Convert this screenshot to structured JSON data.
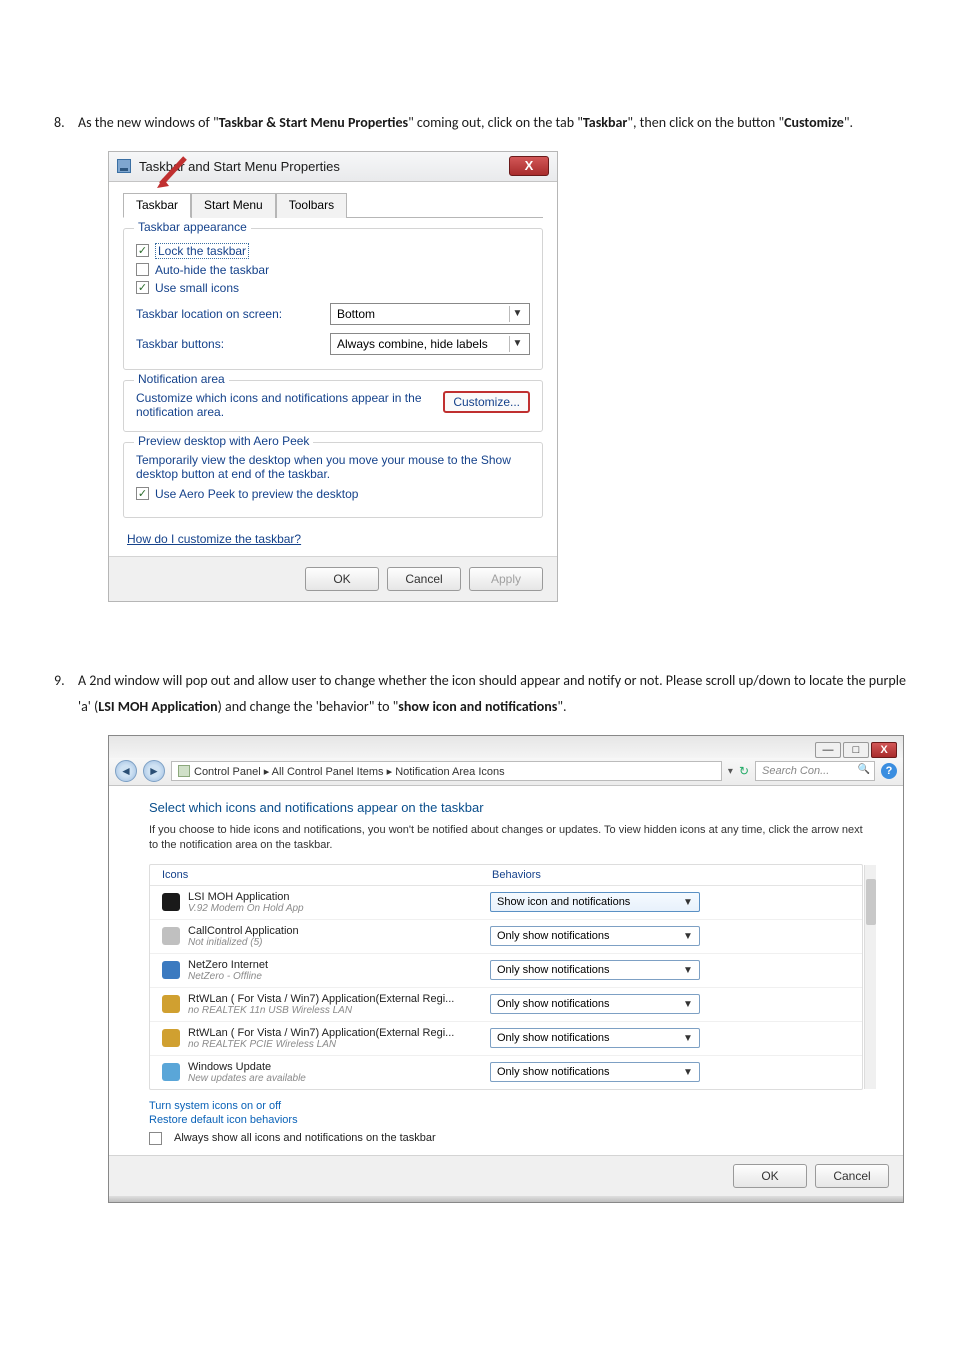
{
  "step8": {
    "num": "8.",
    "pre": "As the new windows of \"",
    "b1": "Taskbar & Start Menu Properties",
    "mid1": "\" coming out, click on the tab \"",
    "b2": "Taskbar",
    "mid2": "\", then click on the button \"",
    "b3": "Customize",
    "end": "\"."
  },
  "dialog1": {
    "title": "Taskbar and Start Menu Properties",
    "close": "X",
    "tabs": {
      "t1": "Taskbar",
      "t2": "Start Menu",
      "t3": "Toolbars"
    },
    "appearanceLegend": "Taskbar appearance",
    "lock": "Lock the taskbar",
    "autohide": "Auto-hide the taskbar",
    "smallicons": "Use small icons",
    "locLabel": "Taskbar location on screen:",
    "locValue": "Bottom",
    "btnsLabel": "Taskbar buttons:",
    "btnsValue": "Always combine, hide labels",
    "notifLegend": "Notification area",
    "notifText": "Customize which icons and notifications appear in the notification area.",
    "custBtn": "Customize...",
    "peekLegend": "Preview desktop with Aero Peek",
    "peekText": "Temporarily view the desktop when you move your mouse to the Show desktop button at end of the taskbar.",
    "peekChk": "Use Aero Peek to preview the desktop",
    "help": "How do I customize the taskbar?",
    "ok": "OK",
    "cancel": "Cancel",
    "apply": "Apply"
  },
  "step9": {
    "num": "9.",
    "pre": " A 2nd window will pop out and allow user to change whether the icon should appear and notify or not.   Please scroll up/down to locate the purple 'a' (",
    "b1": "LSI MOH Application",
    "mid": ") and change the 'behavior\" to \"",
    "b2": "show icon and notifications",
    "end": "\"."
  },
  "page2": {
    "breadcrumb": "Control Panel  ▸  All Control Panel Items  ▸  Notification Area Icons",
    "search": "Search Con...",
    "sep": "▾",
    "refresh": "↻",
    "heading": "Select which icons and notifications appear on the taskbar",
    "sub": "If you choose to hide icons and notifications, you won't be notified about changes or updates. To view hidden icons at any time, click the arrow next to the notification area on the taskbar.",
    "hdrIcons": "Icons",
    "hdrBeh": "Behaviors",
    "rows": [
      {
        "name": "LSI MOH Application",
        "status": "V.92 Modem On Hold App",
        "value": "Show icon and notifications"
      },
      {
        "name": "CallControl Application",
        "status": "Not initialized (5)",
        "value": "Only show notifications"
      },
      {
        "name": "NetZero Internet",
        "status": "NetZero - Offline",
        "value": "Only show notifications"
      },
      {
        "name": "RtWLan ( For Vista / Win7) Application(External Regi...",
        "status": "no REALTEK 11n USB Wireless LAN",
        "value": "Only show notifications"
      },
      {
        "name": "RtWLan ( For Vista / Win7) Application(External Regi...",
        "status": "no REALTEK PCIE Wireless LAN",
        "value": "Only show notifications"
      },
      {
        "name": "Windows Update",
        "status": "New updates are available",
        "value": "Only show notifications"
      }
    ],
    "link1": "Turn system icons on or off",
    "link2": "Restore default icon behaviors",
    "always": "Always show all icons and notifications on the taskbar",
    "ok": "OK",
    "cancel": "Cancel"
  }
}
